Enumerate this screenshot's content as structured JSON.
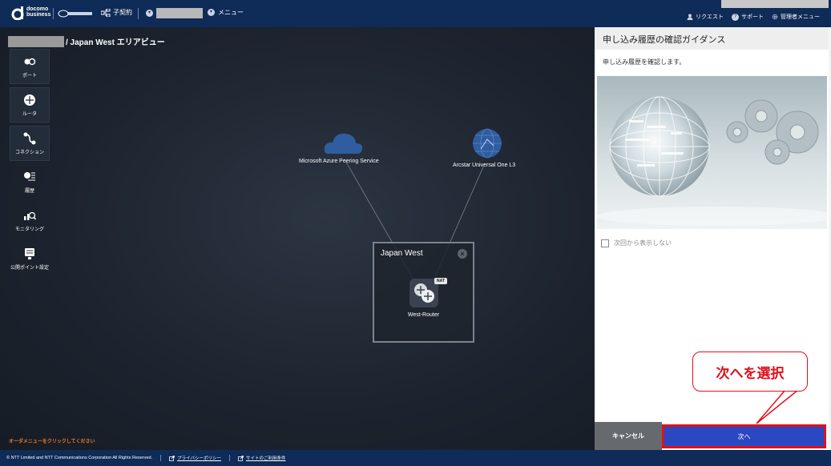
{
  "header": {
    "brand_line1": "docomo",
    "brand_line2": "business",
    "contract_label": "子契約",
    "menu_label": "メニュー",
    "right_links": [
      "リクエスト",
      "サポート",
      "管理者メニュー"
    ]
  },
  "breadcrumb": {
    "text": "/ Japan West エリアビュー"
  },
  "sidebar": {
    "items": [
      {
        "label": "ポート",
        "icon": "port-icon"
      },
      {
        "label": "ルータ",
        "icon": "router-icon"
      },
      {
        "label": "コネクション",
        "icon": "connection-icon"
      },
      {
        "label": "履歴",
        "icon": "history-icon"
      },
      {
        "label": "モニタリング",
        "icon": "monitoring-icon"
      },
      {
        "label": "公開ポイント設定",
        "icon": "publish-point-icon"
      }
    ]
  },
  "map": {
    "nodes": [
      {
        "label": "Microsoft Azure Peering Service",
        "icon": "cloud-icon"
      },
      {
        "label": "Arcstar Universal One L3",
        "icon": "globe-icon"
      }
    ],
    "area": {
      "title": "Japan West",
      "router_label": "West-Router",
      "badge": "NAT"
    },
    "bottom_note": "オーダメニューをクリックしてください"
  },
  "panel": {
    "title": "申し込み履歴の確認ガイダンス",
    "description": "申し込み履歴を確認します。",
    "checkbox_label": "次回から表示しない",
    "cancel_label": "キャンセル",
    "next_label": "次へ"
  },
  "callout": {
    "text": "次へを選択"
  },
  "footer": {
    "copyright": "© NTT Limited and NTT Communications Corporation All Rights Reserved.",
    "privacy": "プライバシーポリシー",
    "terms": "サイトのご利用条件"
  },
  "colors": {
    "header_bg": "#0f2b57",
    "accent_red": "#e0101a",
    "next_button": "#2a48c2",
    "note_orange": "#f07b22"
  }
}
